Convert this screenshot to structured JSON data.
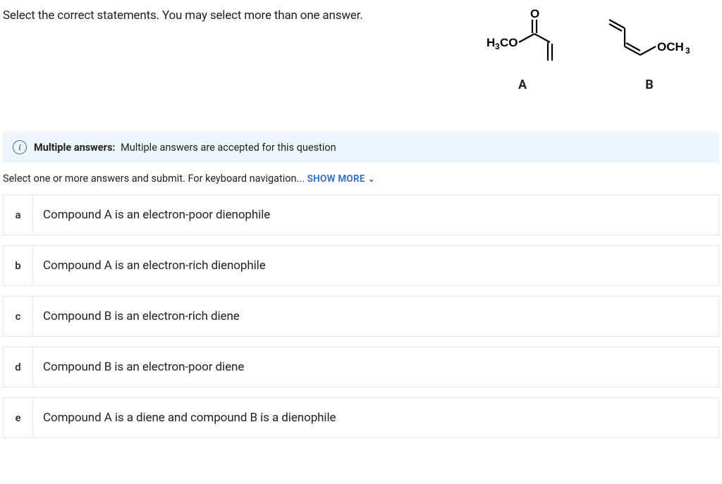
{
  "question": "Select the correct statements. You may select more than one answer.",
  "structures": {
    "a": {
      "label": "A",
      "left_text": "H₃CO",
      "top_text": "O"
    },
    "b": {
      "label": "B",
      "right_text": "OCH₃"
    }
  },
  "info": {
    "bold": "Multiple answers:",
    "text": "Multiple answers are accepted for this question"
  },
  "instructions": {
    "text": "Select one or more answers and submit. For keyboard navigation...",
    "show_more": "SHOW MORE"
  },
  "options": [
    {
      "letter": "a",
      "text": "Compound A is an electron-poor dienophile"
    },
    {
      "letter": "b",
      "text": "Compound A is an electron-rich dienophile"
    },
    {
      "letter": "c",
      "text": "Compound B is an electron-rich diene"
    },
    {
      "letter": "d",
      "text": "Compound B is an electron-poor diene"
    },
    {
      "letter": "e",
      "text": "Compound A is a diene and compound B is a dienophile"
    }
  ]
}
